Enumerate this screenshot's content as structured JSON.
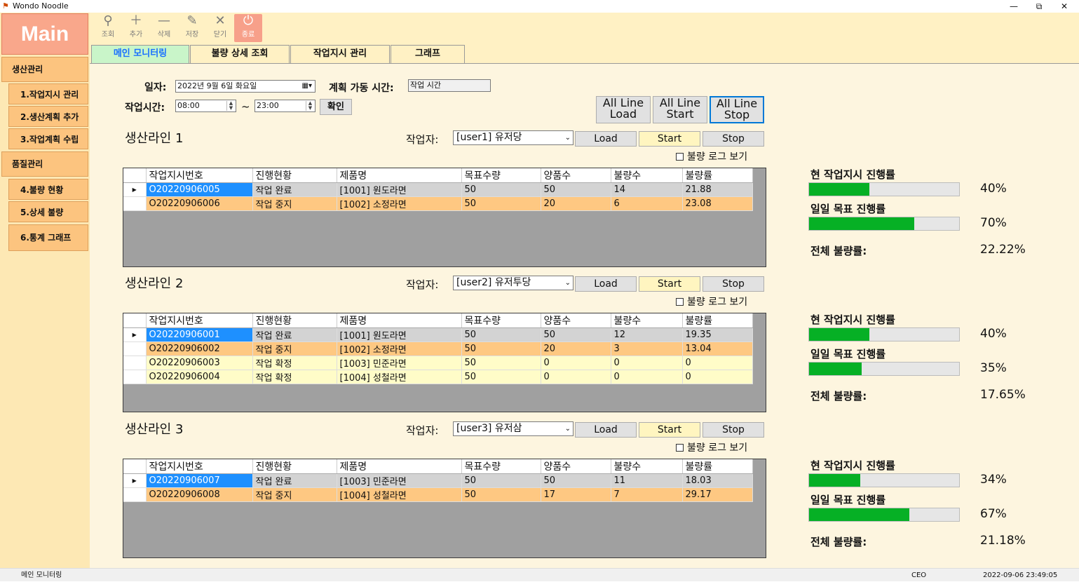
{
  "window": {
    "title": "Wondo Noodle",
    "minimize": "—",
    "restore": "⧉",
    "close": "✕"
  },
  "sidebar": {
    "logo": "Main",
    "items": [
      {
        "label": "생산관리",
        "level": 0
      },
      {
        "label": "1.작업지시 관리",
        "level": 1
      },
      {
        "label": "2.생산계획 추가",
        "level": 1
      },
      {
        "label": "3.작업계획 수립",
        "level": 1
      },
      {
        "label": "품질관리",
        "level": 0
      },
      {
        "label": "4.불량 현황",
        "level": 1
      },
      {
        "label": "5.상세 불량",
        "level": 1
      },
      {
        "label": "6.통계 그래프",
        "level": 1
      }
    ]
  },
  "toolbar": {
    "search": {
      "label": "조회",
      "icon": "search-icon"
    },
    "add": {
      "label": "추가",
      "icon": "plus-icon"
    },
    "delete": {
      "label": "삭제",
      "icon": "minus-icon"
    },
    "save": {
      "label": "저장",
      "icon": "save-icon"
    },
    "close": {
      "label": "닫기",
      "icon": "close-icon"
    },
    "exit": {
      "label": "종료",
      "icon": "power-icon"
    }
  },
  "tabs": [
    "메인 모니터링",
    "불량 상세 조회",
    "작업지시 관리",
    "그래프"
  ],
  "filters": {
    "date_label": "일자:",
    "date_value": "2022년   9월   6일 화요일",
    "plan_label": "계획 가동 시간:",
    "plan_value": "작업 시간",
    "worktime_label": "작업시간:",
    "start_time": "08:00",
    "tilde": "~",
    "end_time": "23:00",
    "confirm": "확인"
  },
  "all_line": {
    "load": [
      "All Line",
      "Load"
    ],
    "start": [
      "All Line",
      "Start"
    ],
    "stop": [
      "All Line",
      "Stop"
    ]
  },
  "common": {
    "worker_label": "작업자:",
    "load": "Load",
    "start": "Start",
    "stop": "Stop",
    "log_check": "불량 로그 보기",
    "columns": [
      "작업지시번호",
      "진행현황",
      "제품명",
      "목표수량",
      "양품수",
      "불량수",
      "불량률"
    ],
    "current_label": "현 작업지시 진행률",
    "daily_label": "일일 목표 진행률",
    "defect_label": "전체 불량률:"
  },
  "lines": [
    {
      "title": "생산라인 1",
      "worker": "[user1] 유저당",
      "rows": [
        [
          "O20220906005",
          "작업 완료",
          "[1001] 원도라면",
          "50",
          "50",
          "14",
          "21.88"
        ],
        [
          "O20220906006",
          "작업 중지",
          "[1002] 소정라면",
          "50",
          "20",
          "6",
          "23.08"
        ]
      ],
      "row_status": [
        "done",
        "stop"
      ],
      "current_progress": 0.4,
      "current_text": "40%",
      "daily_progress": 0.7,
      "daily_text": "70%",
      "defect_rate": "22.22%"
    },
    {
      "title": "생산라인 2",
      "worker": "[user2] 유저투당",
      "rows": [
        [
          "O20220906001",
          "작업 완료",
          "[1001] 원도라면",
          "50",
          "50",
          "12",
          "19.35"
        ],
        [
          "O20220906002",
          "작업 중지",
          "[1002] 소정라면",
          "50",
          "20",
          "3",
          "13.04"
        ],
        [
          "O20220906003",
          "작업 확정",
          "[1003] 민준라면",
          "50",
          "0",
          "0",
          "0"
        ],
        [
          "O20220906004",
          "작업 확정",
          "[1004] 성철라면",
          "50",
          "0",
          "0",
          "0"
        ]
      ],
      "row_status": [
        "done",
        "stop",
        "conf",
        "conf"
      ],
      "current_progress": 0.4,
      "current_text": "40%",
      "daily_progress": 0.35,
      "daily_text": "35%",
      "defect_rate": "17.65%"
    },
    {
      "title": "생산라인 3",
      "worker": "[user3] 유저삼",
      "rows": [
        [
          "O20220906007",
          "작업 완료",
          "[1003] 민준라면",
          "50",
          "50",
          "11",
          "18.03"
        ],
        [
          "O20220906008",
          "작업 중지",
          "[1004] 성철라면",
          "50",
          "17",
          "7",
          "29.17"
        ]
      ],
      "row_status": [
        "done",
        "stop"
      ],
      "current_progress": 0.34,
      "current_text": "34%",
      "daily_progress": 0.67,
      "daily_text": "67%",
      "defect_rate": "21.18%"
    }
  ],
  "status": {
    "screen": "메인 모니터링",
    "user": "CEO",
    "datetime": "2022-09-06 23:49:05"
  },
  "colors": {
    "accent": "#06b025",
    "selected": "#1e90ff",
    "done_row": "#d3d3d3",
    "stop_row": "#fec882",
    "confirm_row": "#fffcc8"
  }
}
